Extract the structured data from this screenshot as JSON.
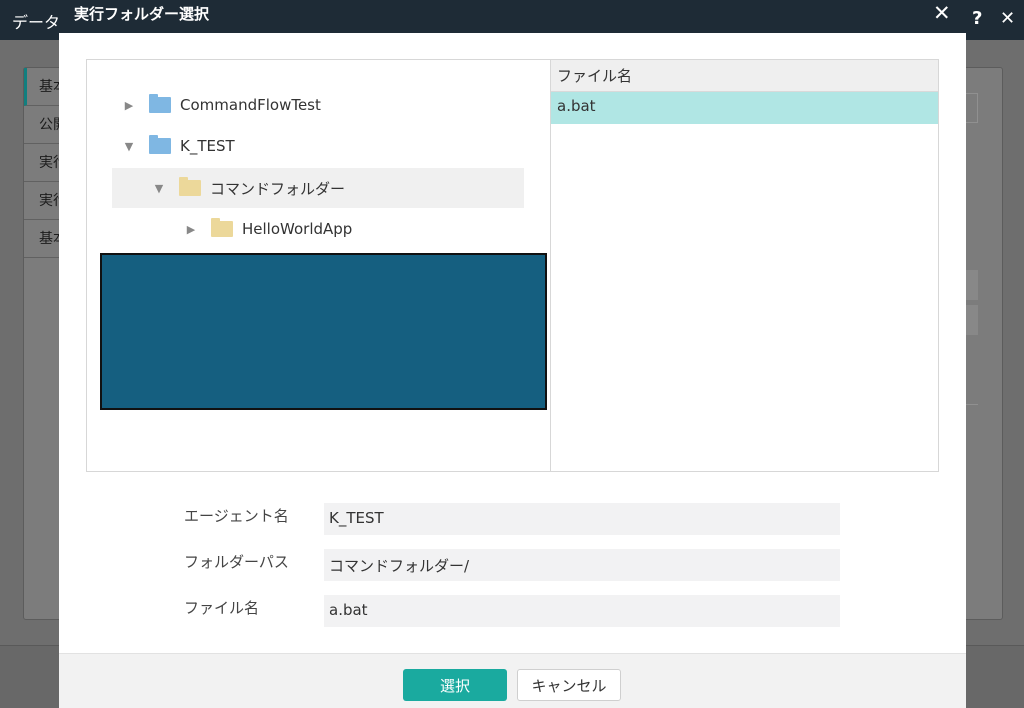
{
  "background": {
    "title": "データ",
    "help_icon": "?",
    "close_icon": "✕",
    "sidebar_items": [
      "基本",
      "公開",
      "実行",
      "実行",
      "基本"
    ]
  },
  "dialog": {
    "title": "実行フォルダー選択",
    "close_icon": "✕",
    "tree": [
      {
        "label": "CommandFlowTest",
        "expanded": false,
        "icon": "folder-blue"
      },
      {
        "label": "K_TEST",
        "expanded": true,
        "icon": "folder-blue"
      },
      {
        "label": "コマンドフォルダー",
        "expanded": true,
        "icon": "folder-yellow",
        "selected": true
      },
      {
        "label": "HelloWorldApp",
        "expanded": false,
        "icon": "folder-yellow"
      }
    ],
    "file_list": {
      "header": "ファイル名",
      "rows": [
        "a.bat"
      ],
      "selected": "a.bat"
    },
    "fields": {
      "agent": {
        "label": "エージェント名",
        "value": "K_TEST"
      },
      "folder_path": {
        "label": "フォルダーパス",
        "value": "コマンドフォルダー/"
      },
      "file_name": {
        "label": "ファイル名",
        "value": "a.bat"
      }
    },
    "buttons": {
      "select": "選択",
      "cancel": "キャンセル"
    },
    "colors": {
      "header_bg": "#1e2b36",
      "primary": "#1aaa9f",
      "selected_file": "#b0e6e4",
      "redaction": "#155f80"
    }
  }
}
